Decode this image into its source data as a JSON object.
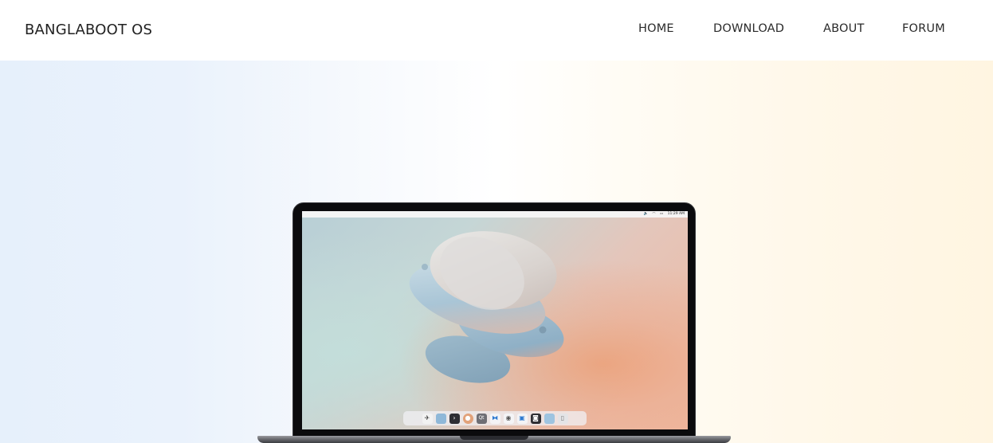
{
  "header": {
    "brand": "BANGLABOOT OS",
    "nav": {
      "home": "HOME",
      "download": "DOWNLOAD",
      "about": "ABOUT",
      "forum": "FORUM"
    }
  },
  "laptop_screen": {
    "menubar": {
      "clock": "11:29 AM"
    },
    "dock_icons": [
      "launcher-icon",
      "files-folder-icon",
      "terminal-icon",
      "firefox-icon",
      "qt-creator-icon",
      "vscode-icon",
      "media-player-icon",
      "gallery-icon",
      "camera-icon",
      "folder-icon",
      "trash-icon"
    ]
  },
  "colors": {
    "hero_left": "#e6f0fb",
    "hero_right": "#fff5e1",
    "brand_text": "#222222",
    "nav_text": "#2a2a2a"
  }
}
